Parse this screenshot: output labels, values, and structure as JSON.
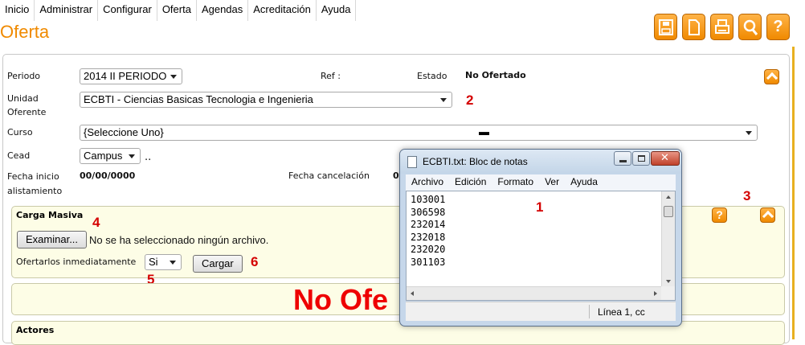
{
  "menu": [
    "Inicio",
    "Administrar",
    "Configurar",
    "Oferta",
    "Agendas",
    "Acreditación",
    "Ayuda"
  ],
  "page_title": "Oferta",
  "toolbar": {
    "help_glyph": "?"
  },
  "form": {
    "periodo_label": "Periodo",
    "periodo_value": "2014 II PERIODO",
    "ref_label": "Ref :",
    "estado_label": "Estado",
    "estado_value": "No Ofertado",
    "unidad_label": "Unidad\nOferente",
    "unidad_value": "ECBTI - Ciencias Basicas Tecnologia e Ingenieria",
    "curso_label": "Curso",
    "curso_value": "{Seleccione Uno}",
    "curso_dash": "▬",
    "cead_label": "Cead",
    "cead_value": "Campus",
    "cead_suffix": "..",
    "fecha_inicio_label": "Fecha inicio\nalistamiento",
    "fecha_inicio_value": "00/00/0000",
    "fecha_cancel_label": "Fecha cancelación",
    "fecha_cancel_value": "0"
  },
  "carga": {
    "title": "Carga Masiva",
    "browse_label": "Examinar...",
    "file_status": "No se ha seleccionado ningún archivo.",
    "ofertar_label": "Ofertarlos inmediatamente",
    "ofertar_value": "Si",
    "cargar_label": "Cargar",
    "help_glyph": "?"
  },
  "status_banner": "No Ofe",
  "actores_title": "Actores",
  "annotations": [
    "1",
    "2",
    "3",
    "4",
    "5",
    "6"
  ],
  "notepad": {
    "title": "ECBTI.txt: Bloc de notas",
    "menu": [
      "Archivo",
      "Edición",
      "Formato",
      "Ver",
      "Ayuda"
    ],
    "lines": [
      "103001",
      "306598",
      "232014",
      "232018",
      "232020",
      "301103"
    ],
    "status_position": "Línea 1, cc"
  },
  "colors": {
    "accent": "#f08a00",
    "alert": "#ee0000",
    "panel": "#fdfde6"
  }
}
